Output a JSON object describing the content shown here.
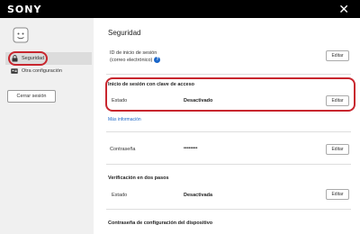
{
  "header": {
    "brand": "SONY",
    "close_glyph": "✕"
  },
  "sidebar": {
    "items": [
      {
        "label": "Seguridad",
        "icon": "lock-icon",
        "active": true
      },
      {
        "label": "Otra configuración",
        "icon": "id-card-icon",
        "active": false
      }
    ],
    "logout_label": "Cerrar sesión"
  },
  "main": {
    "title": "Seguridad",
    "signin_id": {
      "label_line1": "ID de inicio de sesión",
      "label_line2": "(correo electrónico)",
      "info_glyph": "?",
      "edit_label": "Editar"
    },
    "passkey": {
      "title": "Inicio de sesión con clave de acceso",
      "status_label": "Estado",
      "status_value": "Desactivado",
      "edit_label": "Editar",
      "more_info": "Más información"
    },
    "password": {
      "label": "Contraseña",
      "value": "••••••••",
      "edit_label": "Editar"
    },
    "two_step": {
      "title": "Verificación en dos pasos",
      "status_label": "Estado",
      "status_value": "Desactivada",
      "edit_label": "Editar"
    },
    "device_password": {
      "title": "Contraseña de configuración del dispositivo"
    }
  },
  "colors": {
    "accent_link": "#1a66c9",
    "highlight": "#c8262e",
    "topbar": "#000000",
    "sidebar_bg": "#f0f0f0"
  }
}
